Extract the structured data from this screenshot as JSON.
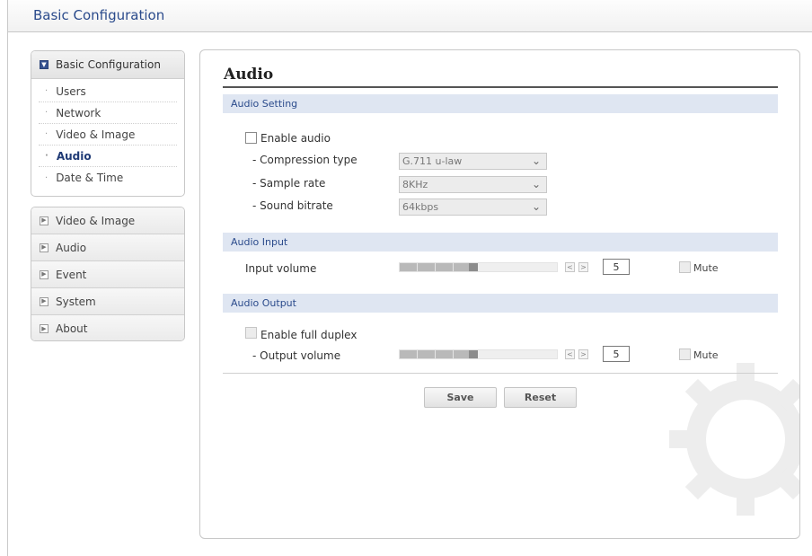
{
  "header": {
    "title": "Basic Configuration"
  },
  "sidebar": {
    "group": {
      "label": "Basic Configuration",
      "items": [
        {
          "label": "Users"
        },
        {
          "label": "Network"
        },
        {
          "label": "Video & Image"
        },
        {
          "label": "Audio",
          "active": true
        },
        {
          "label": "Date & Time"
        }
      ]
    },
    "sections": [
      {
        "label": "Video & Image"
      },
      {
        "label": "Audio"
      },
      {
        "label": "Event"
      },
      {
        "label": "System"
      },
      {
        "label": "About"
      }
    ]
  },
  "main": {
    "title": "Audio",
    "audio_setting": {
      "heading": "Audio Setting",
      "enable_audio": {
        "label": "Enable audio",
        "checked": false
      },
      "compression": {
        "label": "- Compression type",
        "value": "G.711 u-law"
      },
      "sample_rate": {
        "label": "- Sample rate",
        "value": "8KHz"
      },
      "bitrate": {
        "label": "- Sound bitrate",
        "value": "64kbps"
      }
    },
    "audio_input": {
      "heading": "Audio Input",
      "volume_label": "Input volume",
      "volume": "5",
      "dec_label": "<",
      "inc_label": ">",
      "mute_label": "Mute"
    },
    "audio_output": {
      "heading": "Audio Output",
      "full_duplex_label": "Enable full duplex",
      "volume_label": "- Output volume",
      "volume": "5",
      "dec_label": "<",
      "inc_label": ">",
      "mute_label": "Mute"
    },
    "buttons": {
      "save": "Save",
      "reset": "Reset"
    }
  },
  "colors": {
    "accent": "#2b4b8c",
    "section_bg": "#dfe6f2"
  },
  "icons": {
    "expand_open": "square-minus-icon",
    "expand_closed": "square-plus-icon",
    "chevron": "chevron-down-icon"
  }
}
